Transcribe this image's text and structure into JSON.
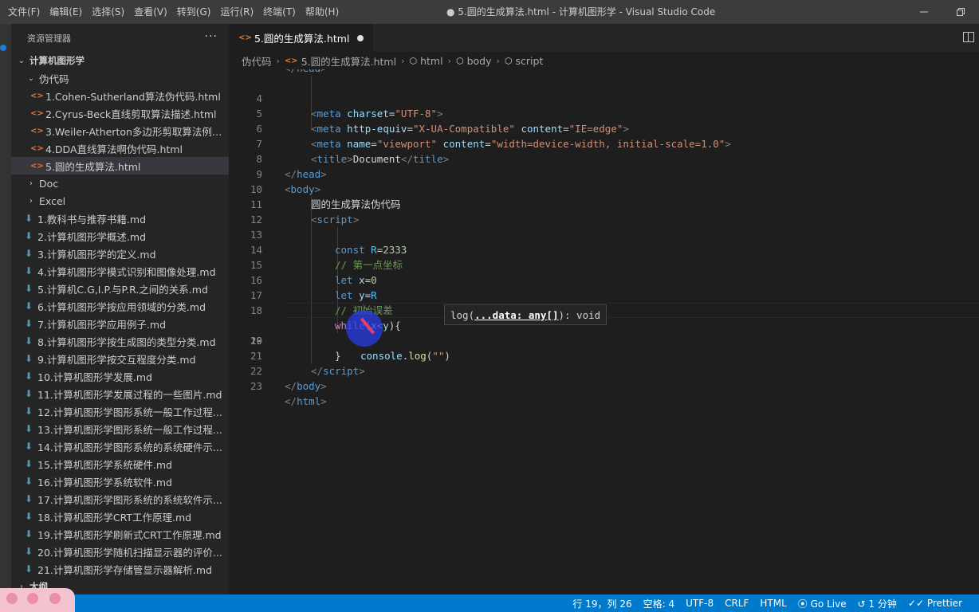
{
  "titlebar": {
    "menu": [
      "文件(F)",
      "编辑(E)",
      "选择(S)",
      "查看(V)",
      "转到(G)",
      "运行(R)",
      "终端(T)",
      "帮助(H)"
    ],
    "title": "● 5.圆的生成算法.html - 计算机图形学 - Visual Studio Code"
  },
  "sidebar": {
    "header": "资源管理器",
    "more": "···",
    "root": "计算机图形学",
    "folder_open": "伪代码",
    "html_files": [
      "1.Cohen-Sutherland算法伪代码.html",
      "2.Cyrus-Beck直线剪取算法描述.html",
      "3.Weiler-Atherton多边形剪取算法例子...",
      "4.DDA直线算法啊伪代码.html",
      "5.圆的生成算法.html"
    ],
    "folders": [
      "Doc",
      "Excel"
    ],
    "md_files": [
      "1.教科书与推荐书籍.md",
      "2.计算机图形学概述.md",
      "3.计算机图形学的定义.md",
      "4.计算机图形学模式识别和图像处理.md",
      "5.计算机C.G,I.P.与P.R.之间的关系.md",
      "6.计算机图形学按应用领域的分类.md",
      "7.计算机图形学应用例子.md",
      "8.计算机图形学按生成图的类型分类.md",
      "9.计算机图形学按交互程度分类.md",
      "10.计算机图形学发展.md",
      "11.计算机图形学发展过程的一些图片.md",
      "12.计算机图形学图形系统一般工作过程...",
      "13.计算机图形学图形系统一般工作过程...",
      "14.计算机图形学图形系统的系统硬件示...",
      "15.计算机图形学系统硬件.md",
      "16.计算机图形学系统软件.md",
      "17.计算机图形学图形系统的系统软件示...",
      "18.计算机图形学CRT工作原理.md",
      "19.计算机图形学刷新式CRT工作原理.md",
      "20.计算机图形学随机扫描显示器的评价...",
      "21.计算机图形学存储管显示器解析.md"
    ],
    "outline": "大纲"
  },
  "editor": {
    "tab_label": "5.圆的生成算法.html",
    "breadcrumb": [
      "伪代码",
      "5.圆的生成算法.html",
      "html",
      "body",
      "script"
    ],
    "line_numbers": [
      "4",
      "5",
      "6",
      "7",
      "8",
      "9",
      "10",
      "11",
      "12",
      "13",
      "14",
      "15",
      "16",
      "17",
      "18",
      "19",
      "20",
      "21",
      "22",
      "23"
    ],
    "hover": {
      "prefix": "log(",
      "param": "...data: any[]",
      "suffix": "): void"
    }
  },
  "statusbar": {
    "items": [
      "行 19，列 26",
      "空格: 4",
      "UTF-8",
      "CRLF",
      "HTML",
      "Go Live",
      "1 分钟",
      "Prettier"
    ]
  }
}
